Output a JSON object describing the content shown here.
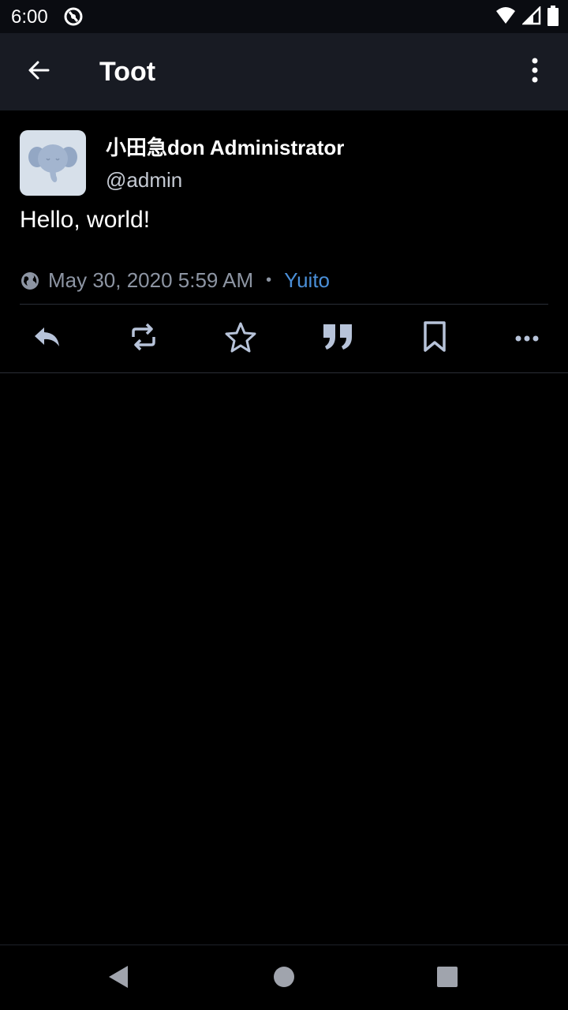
{
  "status_bar": {
    "time": "6:00",
    "icons": [
      "app-notification-icon",
      "wifi-icon",
      "cellular-signal-icon",
      "battery-icon"
    ]
  },
  "app_bar": {
    "title": "Toot",
    "back_icon": "arrow-left-icon",
    "menu_icon": "more-vert-icon"
  },
  "toot": {
    "display_name": "小田急don Administrator",
    "handle": "@admin",
    "content": "Hello, world!",
    "visibility_icon": "globe-icon",
    "timestamp": "May 30, 2020 5:59 AM",
    "separator": "•",
    "application": "Yuito"
  },
  "actions": [
    "reply-icon",
    "boost-icon",
    "favourite-icon",
    "quote-icon",
    "bookmark-icon",
    "more-horiz-icon"
  ],
  "nav_bar": [
    "back-triangle-icon",
    "home-circle-icon",
    "recents-square-icon"
  ],
  "colors": {
    "background": "#000000",
    "app_bar": "#181b23",
    "link": "#4a8fd8",
    "icon": "#b7c3d9",
    "muted_text": "#8d95a3"
  }
}
